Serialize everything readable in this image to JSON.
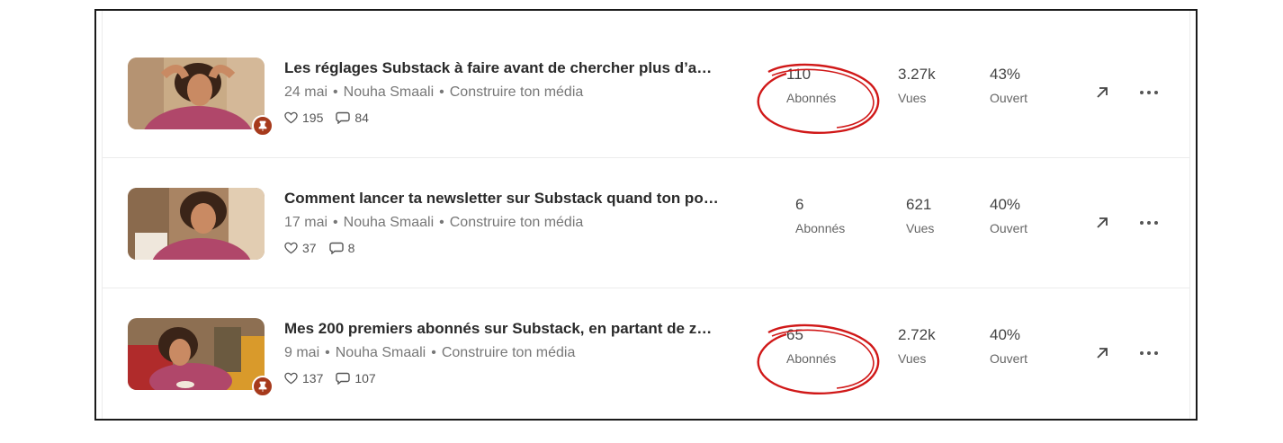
{
  "posts": [
    {
      "title": "Les réglages Substack à faire avant de chercher plus d’a…",
      "date": "24 mai",
      "author": "Nouha Smaali",
      "section": "Construire ton média",
      "likes": "195",
      "comments": "84",
      "subscribers": "110",
      "subscribers_label": "Abonnés",
      "views": "3.27k",
      "views_label": "Vues",
      "open_rate": "43%",
      "open_label": "Ouvert",
      "pinned": true,
      "highlighted": true
    },
    {
      "title": "Comment lancer ta newsletter sur Substack quand ton po…",
      "date": "17 mai",
      "author": "Nouha Smaali",
      "section": "Construire ton média",
      "likes": "37",
      "comments": "8",
      "subscribers": "6",
      "subscribers_label": "Abonnés",
      "views": "621",
      "views_label": "Vues",
      "open_rate": "40%",
      "open_label": "Ouvert",
      "pinned": false,
      "highlighted": false
    },
    {
      "title": "Mes 200 premiers abonnés sur Substack, en partant de z…",
      "date": "9 mai",
      "author": "Nouha Smaali",
      "section": "Construire ton média",
      "likes": "137",
      "comments": "107",
      "subscribers": "65",
      "subscribers_label": "Abonnés",
      "views": "2.72k",
      "views_label": "Vues",
      "open_rate": "40%",
      "open_label": "Ouvert",
      "pinned": true,
      "highlighted": true
    }
  ],
  "separator": "•",
  "icons": {
    "like": "heart-icon",
    "comment": "comment-bubble-icon",
    "open": "arrow-up-right-icon",
    "more": "more-dots-icon",
    "pin": "pin-icon"
  },
  "colors": {
    "pin_badge": "#a63a1c",
    "annotation": "#d01818",
    "sweater": "#b0476a"
  }
}
